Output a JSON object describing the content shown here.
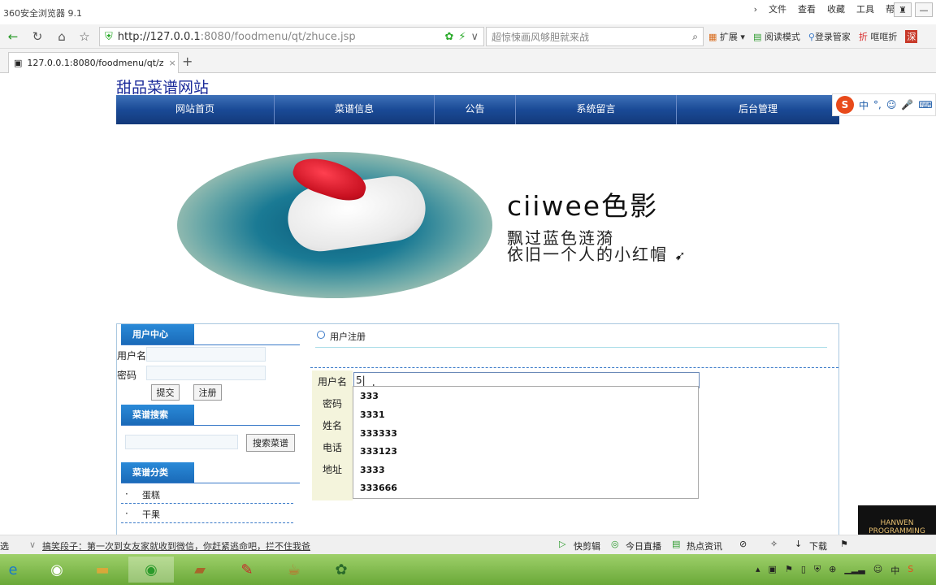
{
  "browser": {
    "title": "360安全浏览器 9.1",
    "menus": [
      "文件",
      "查看",
      "收藏",
      "工具",
      "帮助"
    ],
    "url_host": "http://127.0.0.1",
    "url_rest": ":8080/foodmenu/qt/zhuce.jsp",
    "search_placeholder": "超惊悚画风够胆就来战",
    "tools": [
      "扩展",
      "阅读模式",
      "登录管家",
      "哐哐折"
    ],
    "tab_label": "127.0.0.1:8080/foodmenu/qt/z"
  },
  "site": {
    "title": "甜品菜谱网站",
    "nav": [
      "网站首页",
      "菜谱信息",
      "公告",
      "系统留言",
      "后台管理"
    ],
    "brand": "ciiwee色影",
    "slogan1": "飘过蓝色涟漪",
    "slogan2": "依旧一个人的小红帽"
  },
  "sidebar": {
    "user_center": "用户中心",
    "username_label": "用户名",
    "password_label": "密码",
    "submit": "提交",
    "register": "注册",
    "recipe_search": "菜谱搜索",
    "search_btn": "搜索菜谱",
    "categories_title": "菜谱分类",
    "categories": [
      "蛋糕",
      "干果"
    ]
  },
  "form": {
    "heading": "用户注册",
    "username_label": "用户名",
    "password_label": "密码",
    "name_label": "姓名",
    "phone_label": "电话",
    "address_label": "地址",
    "username_value": "5",
    "suggestions": [
      "333",
      "3331",
      "333333",
      "333123",
      "3333",
      "333666"
    ]
  },
  "ime": {
    "items": [
      "中",
      "°,",
      "☺",
      "🎤",
      "⌨"
    ]
  },
  "status": {
    "left": "选",
    "news": "搞笑段子：第一次到女友家就收到微信，你赶紧逃命吧，拦不住我爸",
    "items": [
      "快剪辑",
      "今日直播",
      "热点资讯",
      "下载"
    ]
  },
  "taskbar": {
    "clock": "中"
  },
  "logo": {
    "text": "HANWEN PROGRAMMING"
  }
}
